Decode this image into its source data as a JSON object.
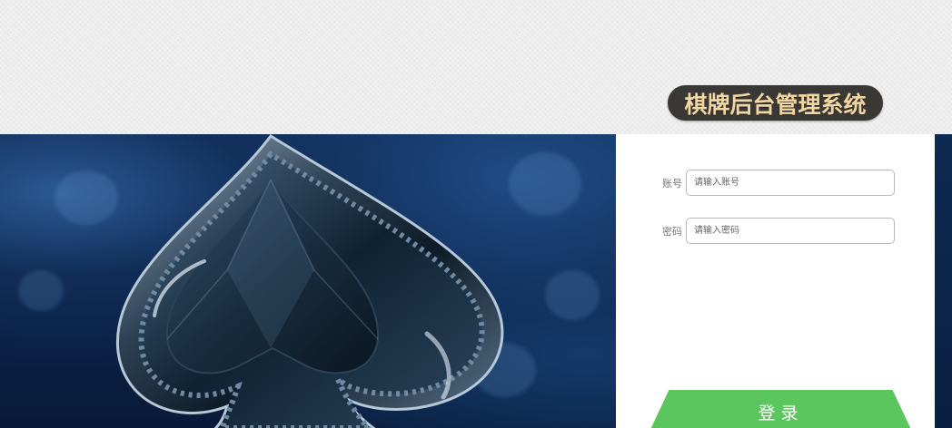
{
  "header": {
    "title": "棋牌后台管理系统"
  },
  "login_form": {
    "account_label": "账号",
    "account_placeholder": "请输入账号",
    "account_value": "",
    "password_label": "密码",
    "password_placeholder": "请输入密码",
    "password_value": "",
    "submit_label": "登录"
  },
  "hero": {
    "image": "spade-card-icon"
  },
  "colors": {
    "title_pill_bg": "#3a3835",
    "title_text": "#f2d7a3",
    "login_button": "#5cc65e",
    "hero_bg": "#0f2d58"
  }
}
